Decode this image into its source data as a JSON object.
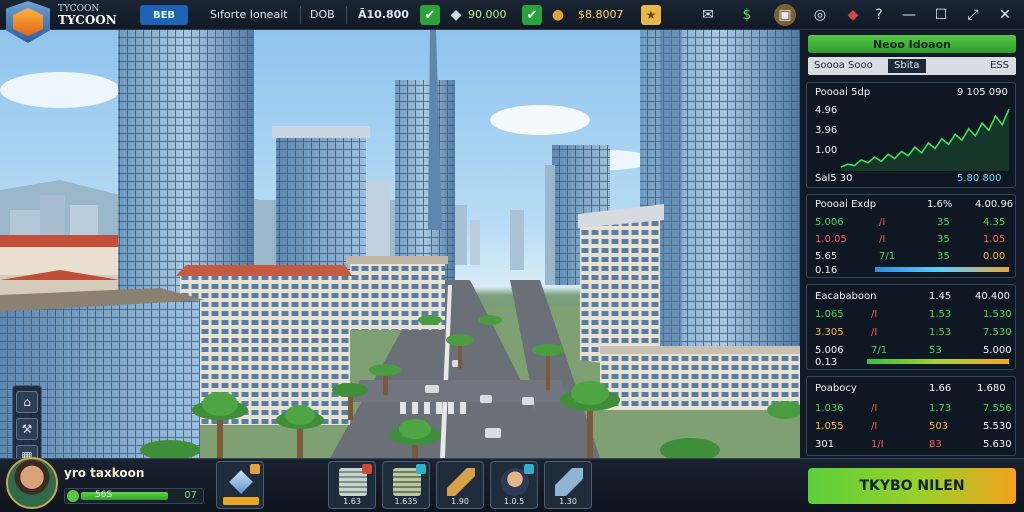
{
  "brand": {
    "line1": "TYCOON",
    "line2": "TYCOON"
  },
  "topbar": {
    "badge": "ВЕВ",
    "menu1": "Sıforte Ioneait",
    "menu2": "DOB",
    "cash1": "Ā10.800",
    "val2": "90.000",
    "val3": "$8.8007"
  },
  "panel": {
    "green_header": "Neoo Idoaon",
    "row_left": "Soooa Sooo",
    "row_mid": "Sbita",
    "row_right": "ESS",
    "chart_title": "Poooai 5dp",
    "chart_value": "9 105 090",
    "chart_y1": "4.96",
    "chart_y2": "3.96",
    "chart_y3": "1.00",
    "chart_footer_left": "Sal5 30",
    "chart_footer_right": "5.80 800",
    "chart_data": {
      "type": "line",
      "values": [
        0.6,
        0.8,
        0.7,
        1.1,
        0.9,
        1.3,
        1.0,
        1.5,
        1.2,
        1.7,
        1.4,
        2.0,
        1.6,
        2.3,
        1.9,
        2.6,
        2.2,
        2.9,
        2.5,
        3.3,
        2.8,
        3.7,
        3.2,
        4.2,
        3.6,
        4.7
      ]
    },
    "card1": {
      "title": "Poooai Exdp",
      "h1": "1.6%",
      "h2": "4.00.96",
      "rows": [
        {
          "a": "5.006",
          "b": "/I",
          "c": "35",
          "d": "4.35"
        },
        {
          "a": "1.0.05",
          "b": "/I",
          "c": "35",
          "d": "1.05"
        },
        {
          "a": "5.65",
          "b": "7/1",
          "c": "35",
          "d": "0.00"
        }
      ],
      "foot": "0.16"
    },
    "card2": {
      "title": "Eacababoon",
      "h1": "1.45",
      "h2": "40.400",
      "rows": [
        {
          "a": "1.065",
          "b": "/I",
          "c": "1.53",
          "d": "1.530"
        },
        {
          "a": "3.305",
          "b": "/I",
          "c": "1.53",
          "d": "7.530"
        },
        {
          "a": "5.006",
          "b": "7/1",
          "c": "53",
          "d": "5.000"
        }
      ],
      "foot": "0.13"
    },
    "card3": {
      "title": "Poabocy",
      "h1": "1.66",
      "h2": "1.680",
      "rows": [
        {
          "a": "1.036",
          "b": "/I",
          "c": "1.73",
          "d": "7.556"
        },
        {
          "a": "1.055",
          "b": "/I",
          "c": "503",
          "d": "5.530"
        },
        {
          "a": "301",
          "b": "1/I",
          "c": "83",
          "d": "5.630"
        }
      ]
    }
  },
  "player": {
    "name": "yro taxkoon",
    "level_label": "56S",
    "level_num": "07",
    "xp_fraction": 0.74
  },
  "slots": [
    {
      "label": ""
    },
    {
      "label": "1.63"
    },
    {
      "label": "1.635"
    },
    {
      "label": "1.90"
    },
    {
      "label": "1.0.5"
    },
    {
      "label": "1.30"
    }
  ],
  "action_button": "TKYBO NILEN",
  "colors": {
    "accent_green": "#57c84a",
    "accent_orange": "#f4a21d",
    "up": "#43d85a",
    "down": "#ff5a4a"
  }
}
